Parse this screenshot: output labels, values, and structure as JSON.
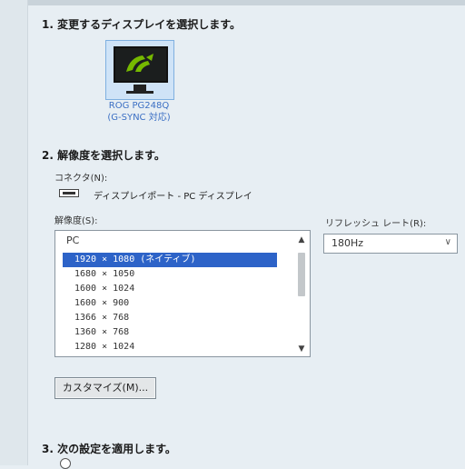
{
  "step1": {
    "title": "1. 変更するディスプレイを選択します。"
  },
  "monitor": {
    "name": "ROG PG248Q",
    "subtitle": "(G-SYNC 対応)",
    "icon": "monitor-icon"
  },
  "step2": {
    "title": "2. 解像度を選択します。",
    "connector_label": "コネクタ(N):",
    "connector_value": "ディスプレイポート - PC ディスプレイ",
    "resolution_label": "解像度(S):",
    "list_group": "PC",
    "resolutions": [
      "1920 × 1080 (ネイティブ)",
      "1680 × 1050",
      "1600 × 1024",
      "1600 × 900",
      "1366 × 768",
      "1360 × 768",
      "1280 × 1024"
    ],
    "selected_index": 0,
    "refresh_label": "リフレッシュ レート(R):",
    "refresh_value": "180Hz",
    "customize_button": "カスタマイズ(M)..."
  },
  "step3": {
    "title": "3. 次の設定を適用します。"
  },
  "colors": {
    "selection": "#2d63c8",
    "caption": "#3b6fc4",
    "tile": "#cfe3f7",
    "logo": "#76b900"
  }
}
